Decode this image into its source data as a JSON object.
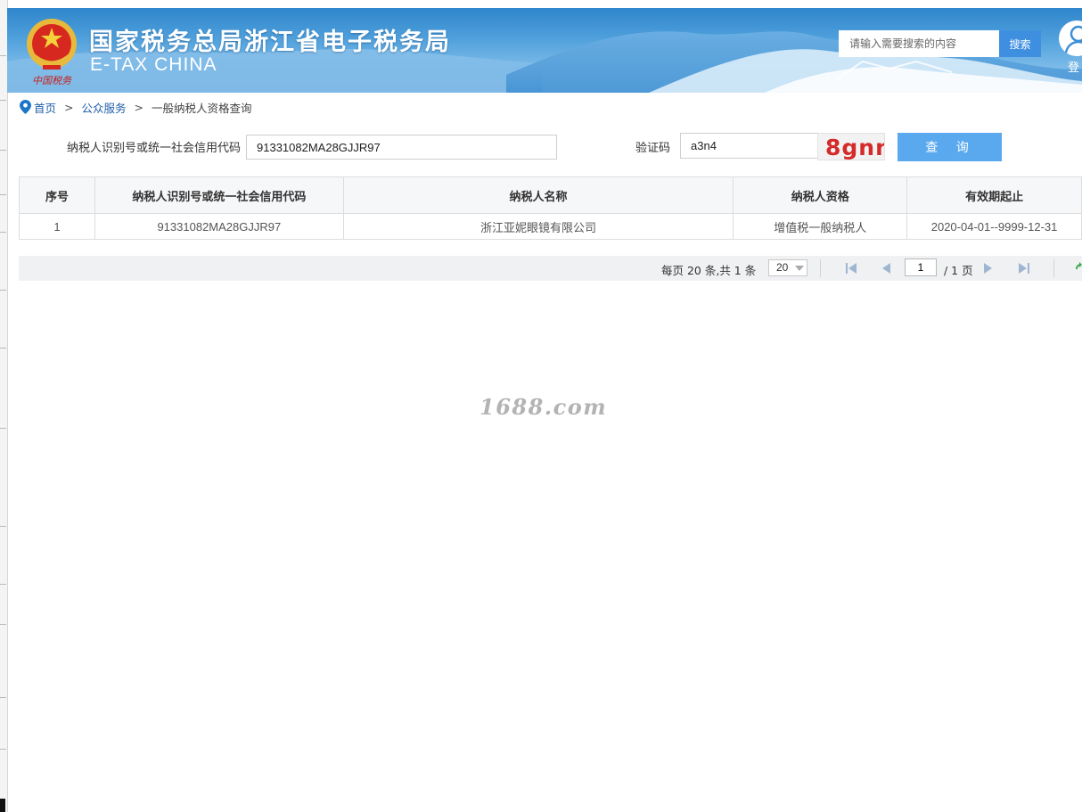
{
  "header": {
    "title": "国家税务总局浙江省电子税务局",
    "subtitle": "E-TAX CHINA",
    "emblem_text": "中国税务",
    "search": {
      "placeholder": "请输入需要搜索的内容",
      "button_label": "搜索"
    },
    "login_label": "登",
    "emblem_icon": "tax-emblem-icon",
    "user_icon": "user-avatar-icon"
  },
  "breadcrumb": {
    "items": [
      "首页",
      "公众服务"
    ],
    "separator": ">",
    "current": "一般纳税人资格查询",
    "icon": "location-pin-icon"
  },
  "query_form": {
    "taxpayer_id_label": "纳税人识别号或统一社会信用代码",
    "taxpayer_id_value": "91331082MA28GJJR97",
    "captcha_label": "验证码",
    "captcha_value": "a3n4",
    "captcha_image_text": "8gnn",
    "submit_label": "查 询"
  },
  "results": {
    "columns": [
      "序号",
      "纳税人识别号或统一社会信用代码",
      "纳税人名称",
      "纳税人资格",
      "有效期起止"
    ],
    "rows": [
      [
        "1",
        "91331082MA28GJJR97",
        "浙江亚妮眼镜有限公司",
        "增值税一般纳税人",
        "2020-04-01--9999-12-31"
      ]
    ]
  },
  "pagination": {
    "summary": "每页 20 条,共 1 条",
    "page_size": "20",
    "current_page": "1",
    "total_pages": "/ 1 页",
    "icons": [
      "first-page-icon",
      "prev-page-icon",
      "next-page-icon",
      "last-page-icon",
      "refresh-icon"
    ]
  },
  "watermark": "1688.com",
  "colors": {
    "banner_blue": "#3a8fd6",
    "search_button": "#3e8fe0",
    "query_button": "#5aa9ee",
    "link": "#1f5fa8",
    "captcha_text": "#d42a2a"
  }
}
